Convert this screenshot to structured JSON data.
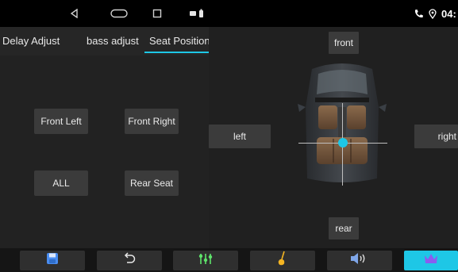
{
  "status_bar": {
    "time": "04:",
    "nav_icons": [
      "back-triangle-icon",
      "home-pill-icon",
      "recents-square-icon",
      "notification-icons"
    ],
    "right_icons": [
      "phone-icon",
      "location-pin-icon"
    ]
  },
  "tabs": [
    {
      "label": "Delay Adjust",
      "active": false
    },
    {
      "label": "bass adjust",
      "active": false
    },
    {
      "label": "Seat Position",
      "active": true
    }
  ],
  "seat_buttons": {
    "front_left": "Front Left",
    "front_right": "Front Right",
    "all": "ALL",
    "rear_seat": "Rear Seat"
  },
  "direction_buttons": {
    "front": "front",
    "left": "left",
    "right": "right",
    "rear": "rear"
  },
  "bottom_toolbar": [
    {
      "icon": "save-icon",
      "active": false
    },
    {
      "icon": "undo-icon",
      "active": false
    },
    {
      "icon": "equalizer-icon",
      "active": false
    },
    {
      "icon": "guitar-icon",
      "active": false
    },
    {
      "icon": "speaker-icon",
      "active": false
    },
    {
      "icon": "crown-icon",
      "active": true
    }
  ],
  "colors": {
    "accent": "#1ec7e6",
    "background": "#1c1c1c",
    "button": "#3b3b3b"
  }
}
